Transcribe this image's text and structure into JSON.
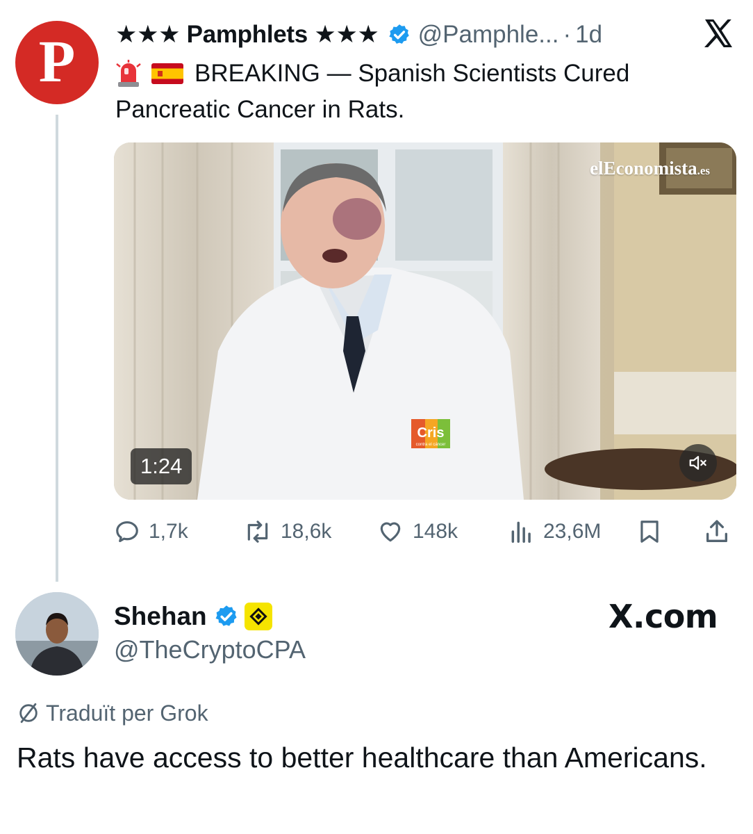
{
  "quoted_tweet": {
    "avatar_letter": "P",
    "display_name": "★★★ Pamphlets ★★★",
    "handle": "@Pamphle...",
    "separator": "·",
    "time": "1d",
    "text_line1": "BREAKING — Spanish Scientists Cured",
    "text_line2": "Pancreatic Cancer in Rats.",
    "video": {
      "duration": "1:24",
      "watermark": "elEconomista",
      "watermark_suffix": ".es",
      "coat_logo": "Cris",
      "coat_logo_sub": "contra el cáncer"
    },
    "stats": {
      "replies": "1,7k",
      "reposts": "18,6k",
      "likes": "148k",
      "views": "23,6M"
    }
  },
  "reply": {
    "display_name": "Shehan",
    "handle": "@TheCryptoCPA",
    "site_label": "X.com",
    "translated_label": "Traduït per Grok",
    "text": "Rats have access to better healthcare than Americans."
  },
  "colors": {
    "avatar_red": "#d42a25",
    "verified_blue": "#1d9bf0",
    "badge_yellow": "#f5e400",
    "muted_text": "#536471",
    "thread_line": "#cfd9de"
  },
  "icons": [
    "x-logo-icon",
    "verified-icon",
    "siren-emoji",
    "spain-flag-emoji",
    "mute-icon",
    "reply-icon",
    "repost-icon",
    "like-icon",
    "views-icon",
    "bookmark-icon",
    "share-icon",
    "translate-icon",
    "affiliate-badge-icon"
  ]
}
